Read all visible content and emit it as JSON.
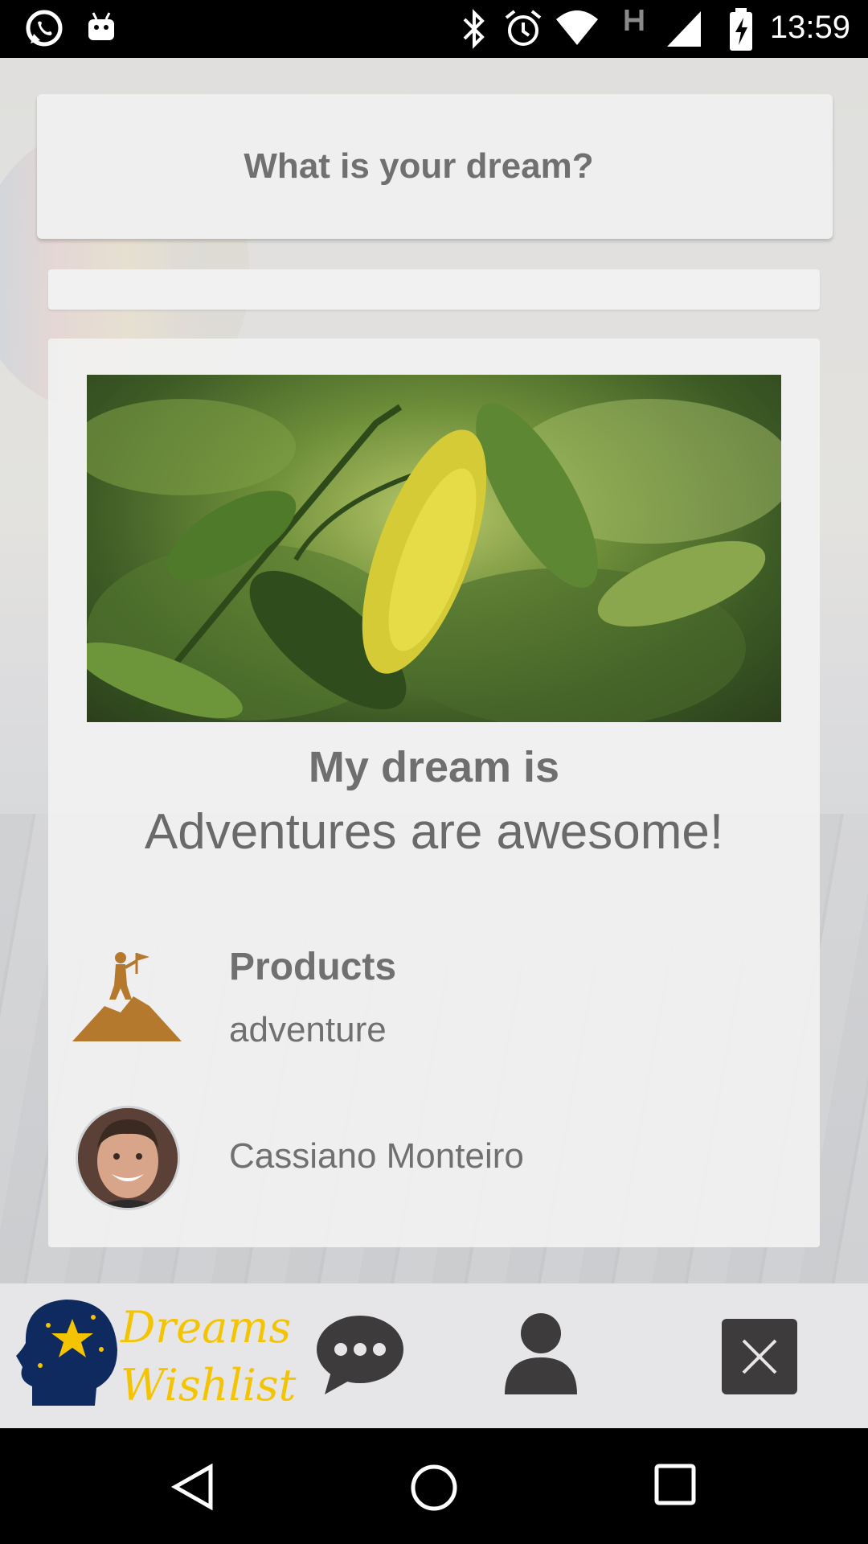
{
  "status_bar": {
    "time": "13:59",
    "left_icons": [
      "whatsapp-icon",
      "android-icon"
    ],
    "right_icons": [
      "bluetooth-icon",
      "alarm-icon",
      "wifi-icon",
      "h-network-icon",
      "signal-icon",
      "battery-charging-icon"
    ]
  },
  "header": {
    "question": "What is your dream?"
  },
  "dream_card": {
    "label": "My dream is",
    "text": "Adventures are awesome!",
    "category_title": "Products",
    "category_value": "adventure",
    "owner_name": "Cassiano Monteiro"
  },
  "app_bar": {
    "logo_line1": "Dreams",
    "logo_line2": "Wishlist",
    "nav_icons": [
      "chat-icon",
      "profile-icon",
      "close-icon"
    ]
  },
  "colors": {
    "accent_yellow": "#f5c400",
    "mountain_brown": "#b5792e",
    "logo_navy": "#0e2a5e",
    "text_gray": "#707070"
  }
}
